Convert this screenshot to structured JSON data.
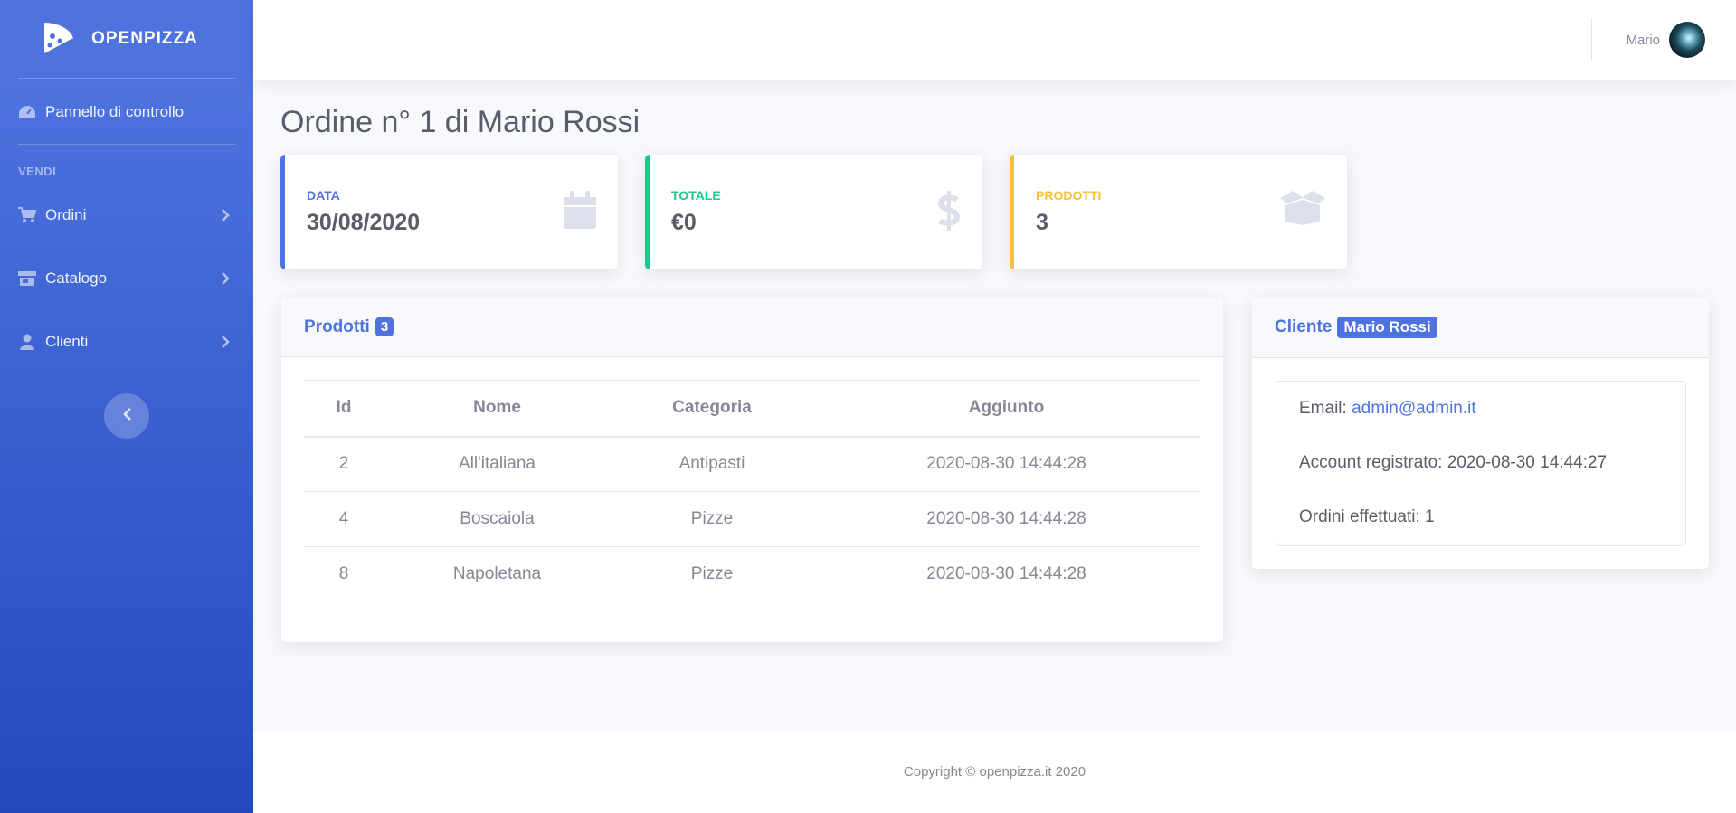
{
  "brand": {
    "name": "OPENPIZZA",
    "icon": "pizza-slice-icon"
  },
  "sidebar": {
    "dashboard": {
      "label": "Pannello di controllo",
      "icon": "tachometer-icon"
    },
    "section_heading": "VENDI",
    "items": [
      {
        "label": "Ordini",
        "icon": "shopping-cart-icon"
      },
      {
        "label": "Catalogo",
        "icon": "store-icon"
      },
      {
        "label": "Clienti",
        "icon": "user-icon"
      }
    ]
  },
  "topbar": {
    "user_name": "Mario"
  },
  "page": {
    "title": "Ordine n° 1 di Mario Rossi"
  },
  "stats": [
    {
      "label": "DATA",
      "value": "30/08/2020",
      "color": "#4e73df",
      "icon": "calendar-icon"
    },
    {
      "label": "TOTALE",
      "value": "€0",
      "color": "#1cc88a",
      "icon": "dollar-icon"
    },
    {
      "label": "PRODOTTI",
      "value": "3",
      "color": "#f6c23e",
      "icon": "box-open-icon"
    }
  ],
  "products": {
    "title": "Prodotti",
    "count": "3",
    "columns": [
      "Id",
      "Nome",
      "Categoria",
      "Aggiunto"
    ],
    "rows": [
      [
        "2",
        "All'italiana",
        "Antipasti",
        "2020-08-30 14:44:28"
      ],
      [
        "4",
        "Boscaiola",
        "Pizze",
        "2020-08-30 14:44:28"
      ],
      [
        "8",
        "Napoletana",
        "Pizze",
        "2020-08-30 14:44:28"
      ]
    ]
  },
  "customer": {
    "title": "Cliente",
    "name": "Mario Rossi",
    "email_label": "Email:",
    "email": "admin@admin.it",
    "registered_line": "Account registrato: 2020-08-30 14:44:27",
    "orders_line": "Ordini effettuati: 1"
  },
  "footer": {
    "text": "Copyright © openpizza.it 2020"
  },
  "colors": {
    "primary": "#4e73df",
    "success": "#1cc88a",
    "warning": "#f6c23e",
    "muted_icon": "#dddfeb"
  }
}
